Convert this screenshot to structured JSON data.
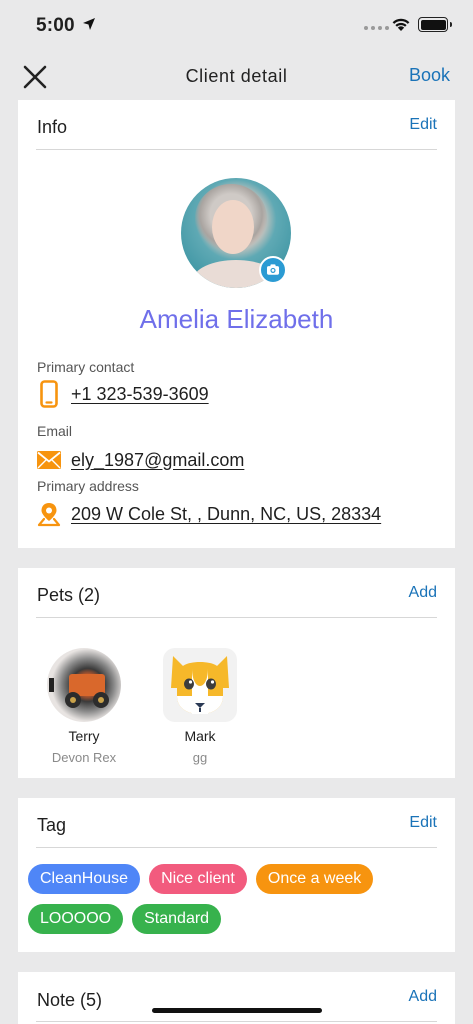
{
  "status": {
    "time": "5:00"
  },
  "nav": {
    "title": "Client detail",
    "book_label": "Book"
  },
  "info": {
    "title": "Info",
    "edit_label": "Edit",
    "name": "Amelia Elizabeth",
    "primary_contact_label": "Primary contact",
    "phone": "+1 323-539-3609",
    "email_label": "Email",
    "email": "ely_1987@gmail.com",
    "address_label": "Primary address",
    "address": "209 W Cole St, , Dunn, NC, US, 28334"
  },
  "pets": {
    "title": "Pets (2)",
    "add_label": "Add",
    "items": [
      {
        "name": "Terry",
        "breed": "Devon Rex"
      },
      {
        "name": "Mark",
        "breed": "gg"
      }
    ]
  },
  "tags": {
    "title": "Tag",
    "edit_label": "Edit",
    "items": [
      {
        "label": "CleanHouse",
        "color": "#4f86f7"
      },
      {
        "label": "Nice client",
        "color": "#f25b7e"
      },
      {
        "label": "Once a week",
        "color": "#f7940f"
      },
      {
        "label": "LOOOOO",
        "color": "#37b24d"
      },
      {
        "label": "Standard",
        "color": "#37b24d"
      }
    ]
  },
  "notes": {
    "title": "Note (5)",
    "add_label": "Add"
  },
  "colors": {
    "accent": "#1a73b8",
    "name": "#6f6fea",
    "icon_orange": "#f7940f",
    "camera": "#2b9bd3"
  }
}
